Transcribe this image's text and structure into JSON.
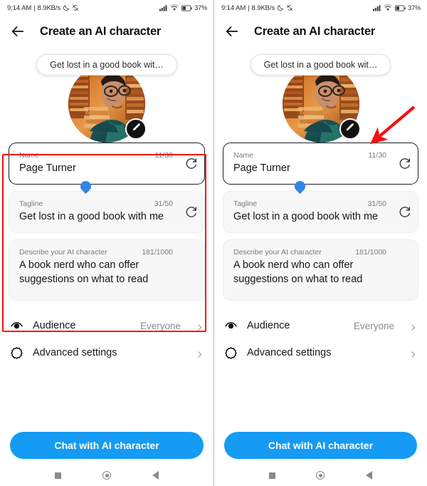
{
  "status_bar": {
    "time": "9:14 AM",
    "separator": "|",
    "network_speed": "8.9KB/s",
    "dnd_icon": "crescent-moon-icon",
    "sync_icon": "sync-disabled-icon",
    "signal_icon": "signal-bars-icon",
    "wifi_icon": "wifi-icon",
    "battery_icon": "battery-icon",
    "battery_level": "37%"
  },
  "app_bar": {
    "back_icon": "back-arrow-icon",
    "title": "Create an AI character"
  },
  "hero": {
    "bubble_text": "Get lost in a good book wit…",
    "avatar_alt": "ai-character-avatar",
    "edit_icon": "pencil-icon"
  },
  "fields": [
    {
      "id": "name",
      "label": "Name",
      "counter": "11/30",
      "value": "Page Turner",
      "focused": true,
      "multiline": false,
      "refresh_icon": "refresh-icon"
    },
    {
      "id": "tagline",
      "label": "Tagline",
      "counter": "31/50",
      "value": "Get lost in a good book with me",
      "focused": false,
      "multiline": false,
      "refresh_icon": "refresh-icon"
    },
    {
      "id": "description",
      "label": "Describe your AI character",
      "counter": "181/1000",
      "value": "A book nerd who can offer suggestions on what to read",
      "focused": false,
      "multiline": true,
      "refresh_icon": "refresh-icon"
    }
  ],
  "rows": [
    {
      "id": "audience",
      "icon": "eye-audience-icon",
      "label": "Audience",
      "value": "Everyone",
      "chevron": "chevron-right-icon"
    },
    {
      "id": "advanced-settings",
      "icon": "gear-settings-icon",
      "label": "Advanced settings",
      "value": "",
      "chevron": "chevron-right-icon"
    }
  ],
  "cta": {
    "label": "Chat with AI character",
    "color": "#159bf3"
  },
  "nav_bar": {
    "recents_icon": "square-recents-icon",
    "home_icon": "circle-home-icon",
    "back_icon": "triangle-back-icon"
  },
  "annotations": {
    "highlight_color": "#fb0d10",
    "highlight_box_target": "form-fields-group",
    "arrow_color": "#fb0d10",
    "arrow_target": "avatar-edit-button"
  }
}
